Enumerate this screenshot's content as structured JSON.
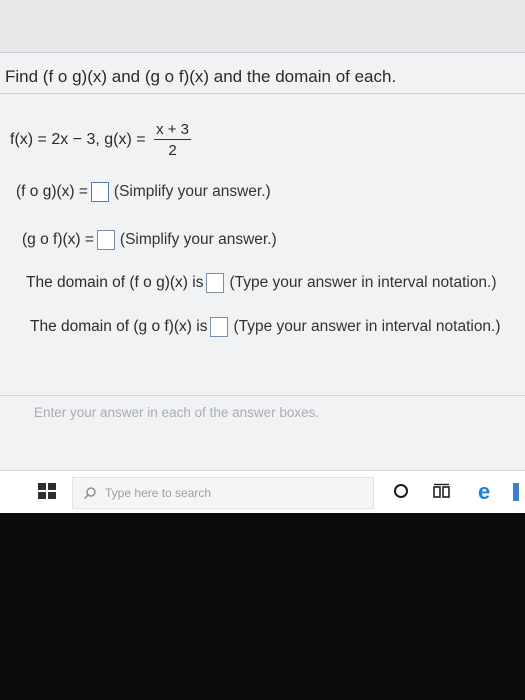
{
  "question": "Find (f o g)(x) and (g o f)(x) and the domain of each.",
  "definitions": {
    "prefix": "f(x) = 2x − 3, g(x) =",
    "fraction_numerator": "x + 3",
    "fraction_denominator": "2"
  },
  "rows": [
    {
      "label": "(f o g)(x) =",
      "hint": "(Simplify your answer.)"
    },
    {
      "label": "(g o f)(x) =",
      "hint": "(Simplify your answer.)"
    },
    {
      "label": "The domain of (f o g)(x) is",
      "hint": "(Type your answer in interval notation.)"
    },
    {
      "label": "The domain of (g o f)(x) is",
      "hint": "(Type your answer in interval notation.)"
    }
  ],
  "footer_note": "Enter your answer in each of the answer boxes.",
  "taskbar": {
    "search_placeholder": "Type here to search",
    "icons": [
      "windows-start-icon",
      "search-icon",
      "cortana-icon",
      "task-view-icon",
      "edge-icon"
    ],
    "edge_glyph": "e"
  },
  "colors": {
    "answer_box_border": "#7a8ea8",
    "edge_blue": "#1f82d6"
  }
}
